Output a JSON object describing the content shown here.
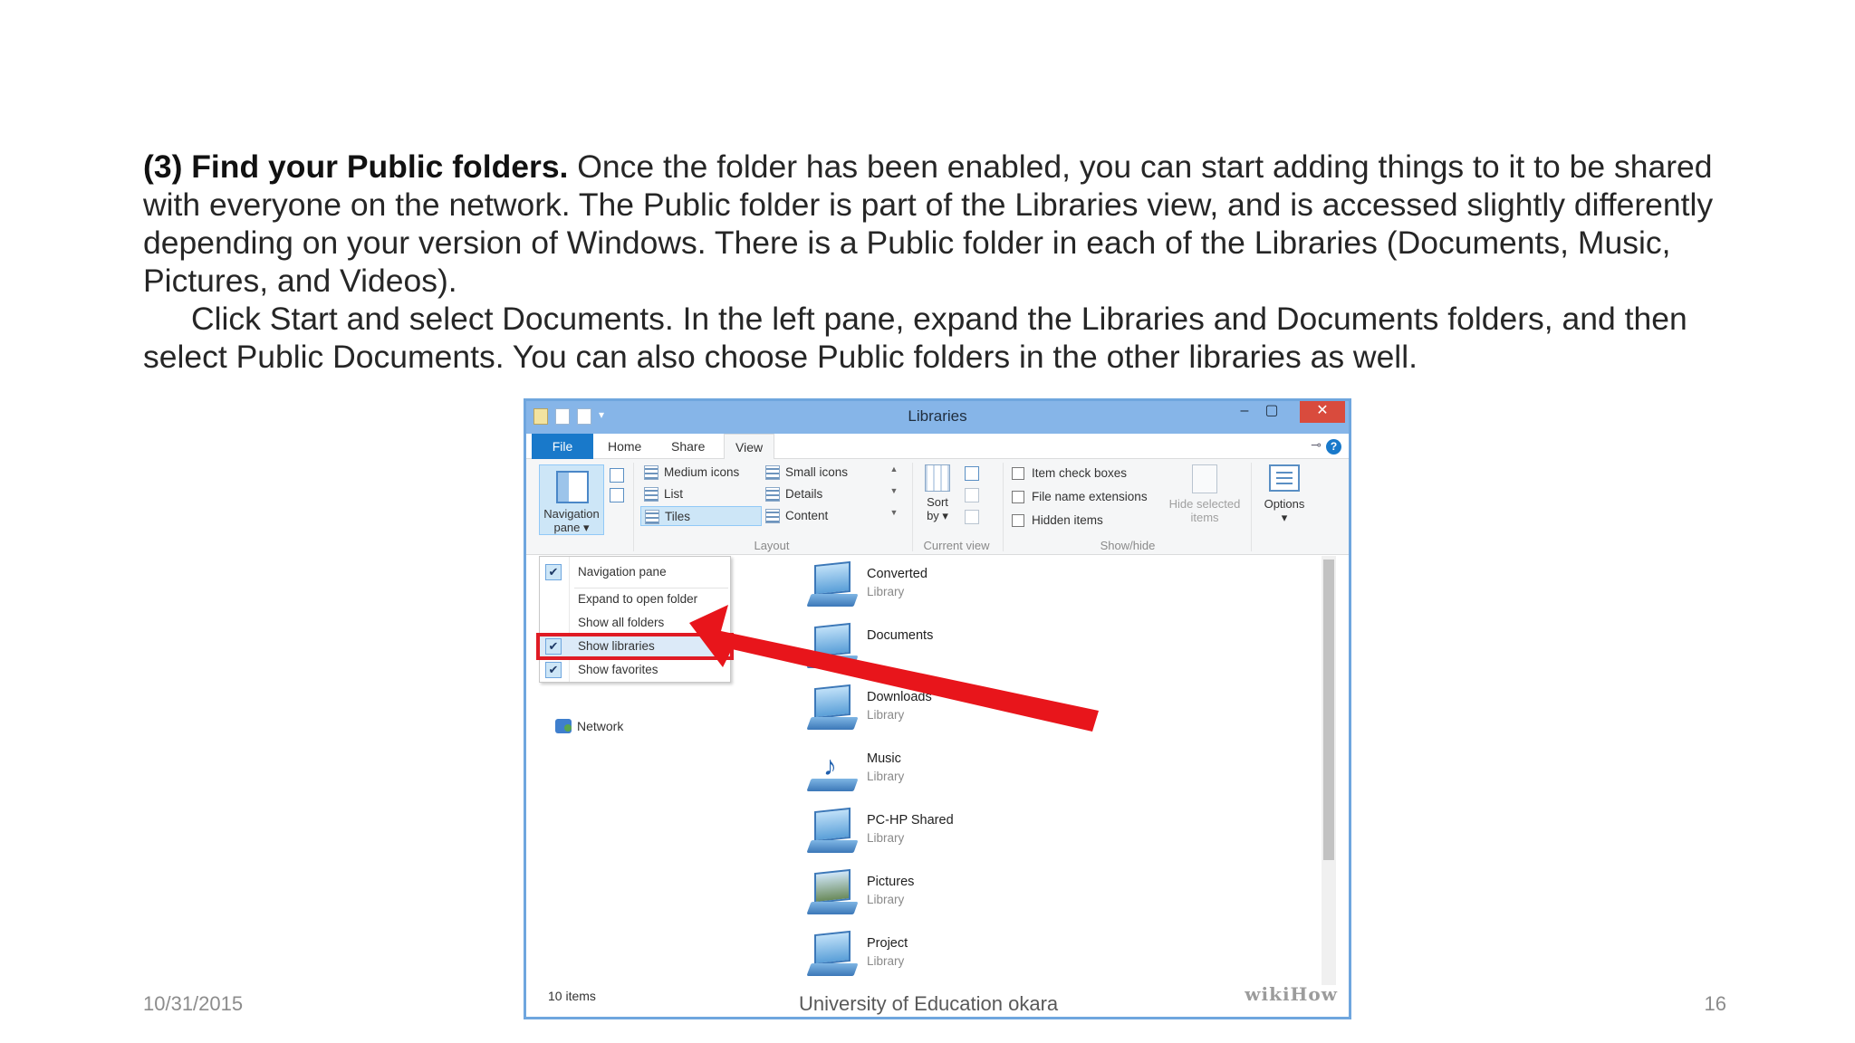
{
  "slide": {
    "heading_bold": "(3) Find your Public folders.",
    "paragraph1": " Once the folder has been enabled, you can start adding things to it to be shared with everyone on the network. The Public folder is part of the Libraries view, and is accessed slightly differently depending on your version of Windows. There is a Public folder in each of the Libraries (Documents, Music, Pictures, and Videos).",
    "paragraph2": "Click Start and select Documents. In the left pane, expand the Libraries and Documents folders, and then select Public Documents. You can also choose Public folders in the other libraries as well."
  },
  "footer": {
    "date": "10/31/2015",
    "center": "University of Education okara",
    "page": "16"
  },
  "window": {
    "title": "Libraries",
    "buttons": {
      "minimize": "–",
      "maximize": "▢",
      "close": "✕"
    },
    "tabs": {
      "file": "File",
      "home": "Home",
      "share": "Share",
      "view": "View"
    },
    "help": "?",
    "ribbon": {
      "panes": {
        "navigation_pane_label_1": "Navigation",
        "navigation_pane_label_2": "pane ▾"
      },
      "layout": {
        "items": [
          "Medium icons",
          "List",
          "Tiles",
          "Small icons",
          "Details",
          "Content"
        ],
        "group_label": "Layout"
      },
      "current_view": {
        "sort_label_1": "Sort",
        "sort_label_2": "by ▾",
        "group_label": "Current view"
      },
      "show_hide": {
        "checkboxes": [
          "Item check boxes",
          "File name extensions",
          "Hidden items"
        ],
        "hide_selected_1": "Hide selected",
        "hide_selected_2": "items",
        "group_label": "Show/hide"
      },
      "options_label": "Options",
      "options_caret": "▾"
    },
    "dropdown": {
      "items": [
        {
          "label": "Navigation pane",
          "checked": true
        },
        {
          "label": "Expand to open folder",
          "checked": false
        },
        {
          "label": "Show all folders",
          "checked": false
        },
        {
          "label": "Show libraries",
          "checked": true,
          "highlighted": true
        },
        {
          "label": "Show favorites",
          "checked": true
        }
      ],
      "check_glyph": "✔"
    },
    "left_pane": {
      "network": "Network"
    },
    "libraries": [
      {
        "name": "Converted",
        "sub": "Library"
      },
      {
        "name": "Documents",
        "sub": ""
      },
      {
        "name": "Downloads",
        "sub": "Library"
      },
      {
        "name": "Music",
        "sub": "Library"
      },
      {
        "name": "PC-HP Shared",
        "sub": "Library"
      },
      {
        "name": "Pictures",
        "sub": "Library"
      },
      {
        "name": "Project",
        "sub": "Library"
      }
    ],
    "status": {
      "count": "10 items"
    },
    "watermark": "wikiHow",
    "accent_colors": {
      "highlight_red": "#e01b24",
      "file_tab_blue": "#1979ca"
    }
  }
}
